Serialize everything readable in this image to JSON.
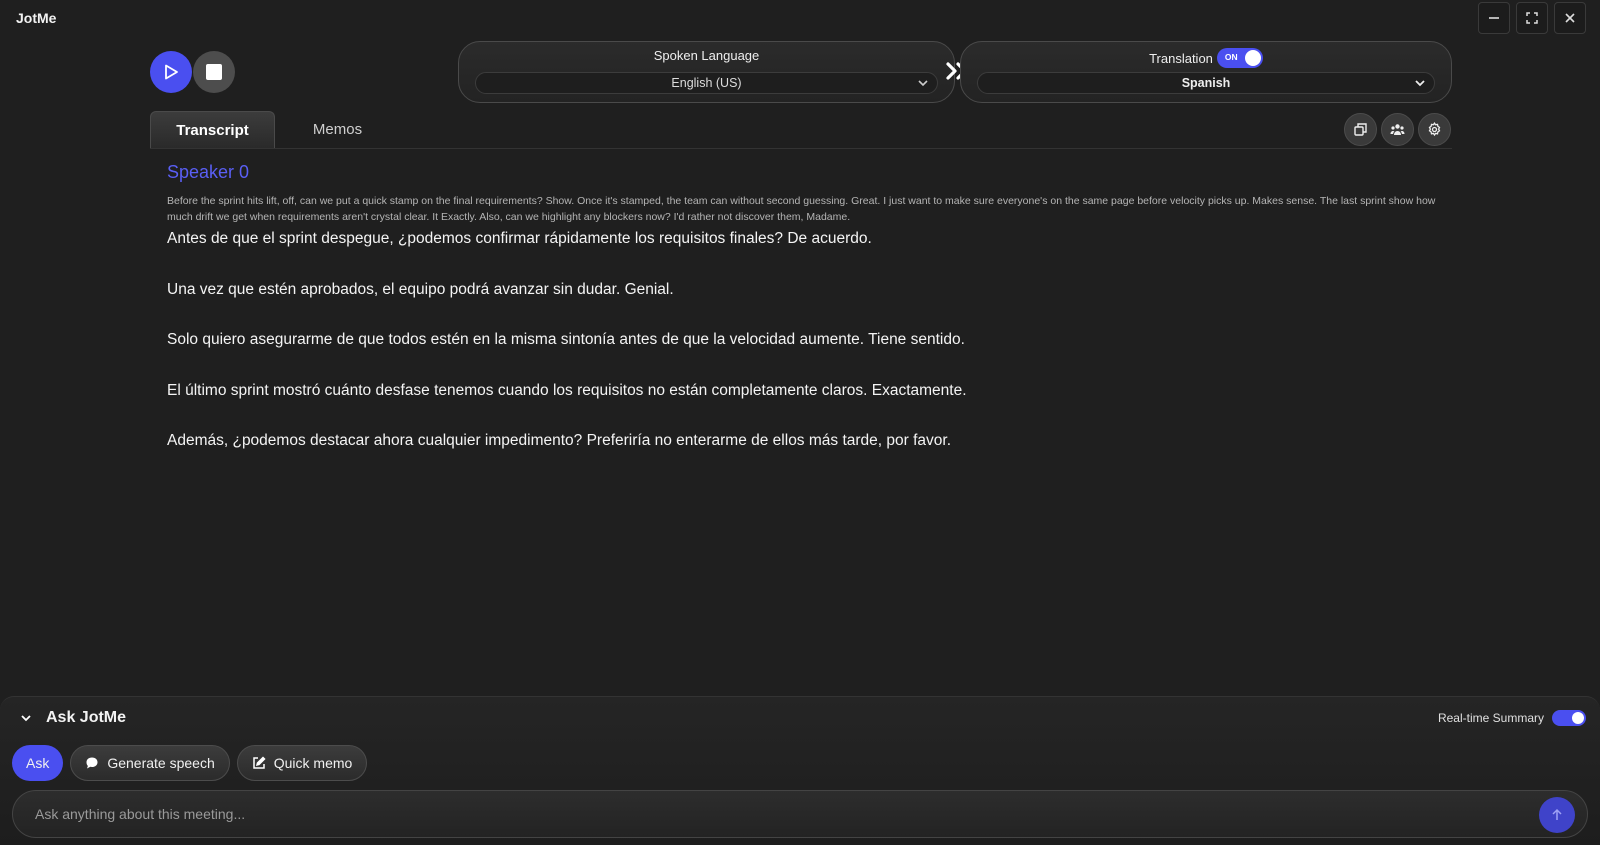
{
  "app": {
    "title": "JotMe"
  },
  "window": {
    "icons": [
      "minimize-icon",
      "fullscreen-icon",
      "close-icon"
    ]
  },
  "controls": {
    "icons": [
      "play-icon",
      "stop-icon"
    ]
  },
  "spoken_language": {
    "label": "Spoken Language",
    "selected": "English (US)"
  },
  "translation": {
    "label": "Translation",
    "toggle_text": "ON",
    "enabled": true,
    "selected": "Spanish"
  },
  "tabs": [
    {
      "label": "Transcript",
      "active": true
    },
    {
      "label": "Memos",
      "active": false
    }
  ],
  "tools": {
    "icons": [
      "copy-icon",
      "speakers-icon",
      "settings-icon"
    ]
  },
  "transcript": {
    "speaker": "Speaker 0",
    "source": "Before the sprint hits lift, off, can we put a quick stamp on the final requirements? Show. Once it's stamped, the team can without second guessing. Great. I just want to make sure everyone's on the same page before velocity picks up. Makes sense. The last sprint show how much drift we get when requirements aren't crystal clear. It Exactly. Also, can we highlight any blockers now? I'd rather not discover them, Madame.",
    "translated": [
      "Antes de que el sprint despegue, ¿podemos confirmar rápidamente los requisitos finales? De acuerdo.",
      "Una vez que estén aprobados, el equipo podrá avanzar sin dudar. Genial.",
      "Solo quiero asegurarme de que todos estén en la misma sintonía antes de que la velocidad aumente. Tiene sentido.",
      "El último sprint mostró cuánto desfase tenemos cuando los requisitos no están completamente claros. Exactamente.",
      "Además, ¿podemos destacar ahora cualquier impedimento? Preferiría no enterarme de ellos más tarde, por favor."
    ]
  },
  "ask": {
    "title": "Ask JotMe",
    "summary_label": "Real-time Summary",
    "summary_enabled": true,
    "actions": {
      "ask": "Ask",
      "generate_speech": "Generate speech",
      "quick_memo": "Quick memo"
    },
    "input_placeholder": "Ask anything about this meeting...",
    "accent": "#4a4ff0"
  }
}
